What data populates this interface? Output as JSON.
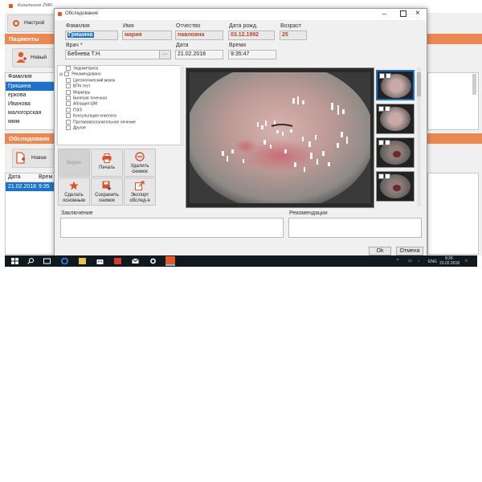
{
  "main_window": {
    "title": "Кольпоскоп ZMR",
    "settings_button": "Настрой",
    "patients_header": "Пациенты",
    "new_patient_button": "Новый",
    "patients_column": "Фамилия",
    "patients": [
      "Гришина",
      "еркова",
      "Иванова",
      "малогорская",
      "ммм"
    ],
    "selected_patient_index": 0,
    "exams_header": "Обследовани",
    "new_exam_button": "Новое",
    "exam_columns": [
      "Дата",
      "Врем"
    ],
    "exams": [
      {
        "date": "21.02.2018",
        "time": "9:35"
      }
    ]
  },
  "dialog": {
    "title": "Обследование",
    "labels": {
      "lastname": "Фамилия",
      "firstname": "Имя",
      "patronymic": "Отчество",
      "birthdate": "Дата рожд.",
      "age": "Возраст",
      "doctor": "Врач *",
      "date": "Дата",
      "time": "Время"
    },
    "values": {
      "lastname": "Гришина",
      "firstname": "мария",
      "patronymic": "павловна",
      "birthdate": "03.12.1992",
      "age": "25",
      "doctor": "Бебнева Т.Н.",
      "date": "21.02.2018",
      "time": "9:35:47"
    },
    "doctor_browse": "...",
    "tree_top": "Эндометриоз",
    "tree_group": "Рекомендовано",
    "tree_items": [
      "Цитологический мазок",
      "ВПЧ тест",
      "Маркеры",
      "Биопсия точечная",
      "Аблация ШМ",
      "ПЭЭ",
      "Консультация онколога",
      "Противовоспалительное лечение",
      "Другое"
    ],
    "tools": {
      "disabled": "Видео",
      "print": "Печать",
      "delete_line1": "Удалить",
      "delete_line2": "снимок",
      "make_main_line1": "Сделать",
      "make_main_line2": "основным",
      "save_line1": "Сохранить",
      "save_line2": "снимок",
      "export_line1": "Экспорт",
      "export_line2": "обслед-я"
    },
    "conclusion_label": "Заключение",
    "recommendations_label": "Рекомендации",
    "ok_button": "Ok",
    "cancel_button": "Отмена"
  },
  "taskbar": {
    "lang": "ENG",
    "time": "9:26",
    "date": "23.02.2018"
  },
  "colors": {
    "accent_orange": "#ea8a52",
    "selection_blue": "#1e73c8",
    "taskbar": "#101820"
  }
}
